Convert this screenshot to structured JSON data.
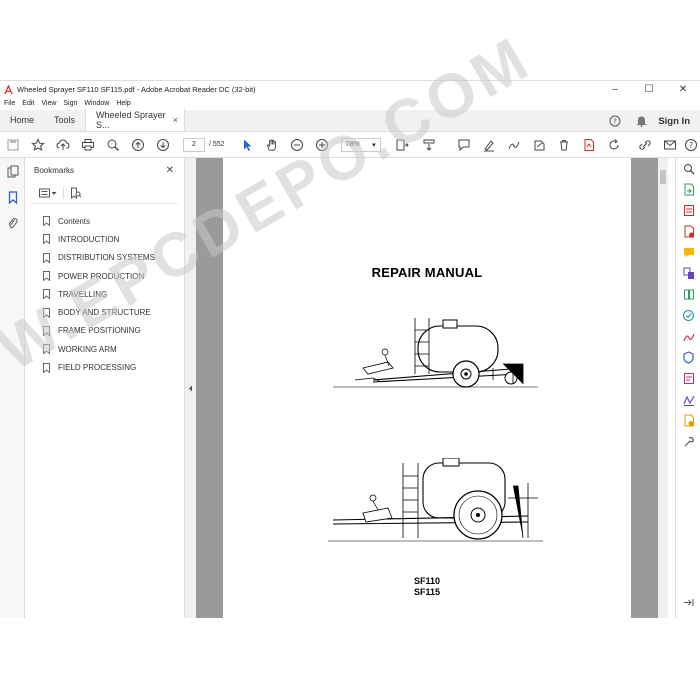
{
  "window": {
    "title": "Wheeled Sprayer SF110 SF115.pdf - Adobe Acrobat Reader DC (32-bit)"
  },
  "menu": [
    "File",
    "Edit",
    "View",
    "Sign",
    "Window",
    "Help"
  ],
  "tabs": {
    "home": "Home",
    "tools": "Tools",
    "document": "Wheeled Sprayer S...",
    "close_glyph": "×"
  },
  "header": {
    "sign_in": "Sign In"
  },
  "toolbar": {
    "page_current": "2",
    "page_total": "/ 552",
    "zoom": "78%"
  },
  "bookmarks": {
    "title": "Bookmarks",
    "items": [
      "Contents",
      "INTRODUCTION",
      "DISTRIBUTION SYSTEMS",
      "POWER PRODUCTION",
      "TRAVELLING",
      "BODY AND STRUCTURE",
      "FRAME POSITIONING",
      "WORKING ARM",
      "FIELD PROCESSING"
    ]
  },
  "document": {
    "heading": "REPAIR MANUAL",
    "model_1": "SF110",
    "model_2": "SF115",
    "watermark": "WWW.EPCDEPO.COM"
  },
  "colors": {
    "accent_blue": "#2e62c4",
    "adobe_red": "#d9262b",
    "doc_background": "#9a9a9a"
  }
}
